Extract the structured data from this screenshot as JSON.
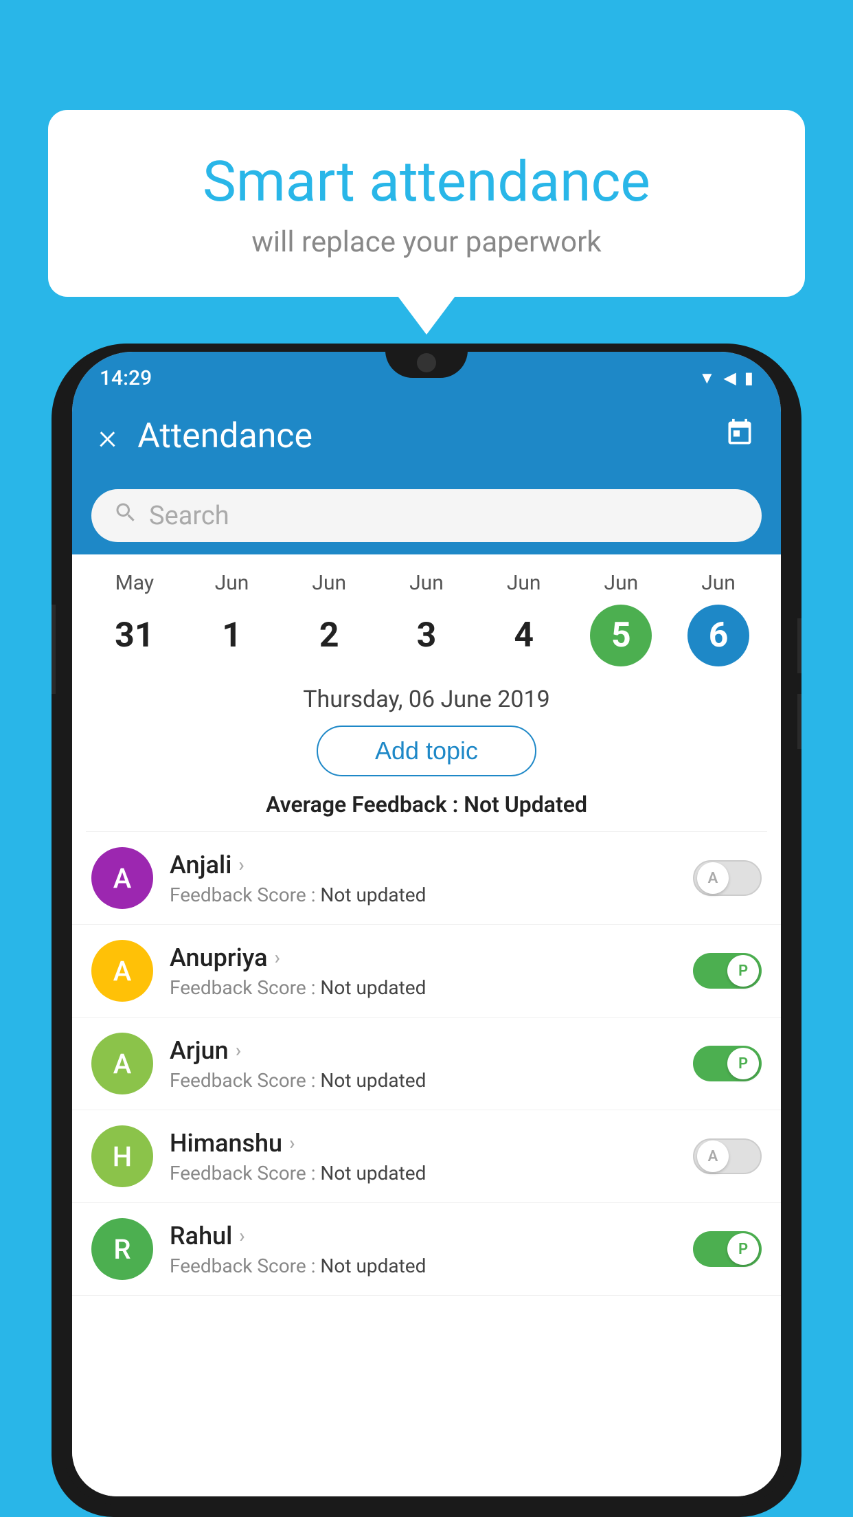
{
  "background_color": "#29B6E8",
  "speech_bubble": {
    "title": "Smart attendance",
    "subtitle": "will replace your paperwork"
  },
  "status_bar": {
    "time": "14:29",
    "icons": [
      "wifi",
      "signal",
      "battery"
    ]
  },
  "app_bar": {
    "title": "Attendance",
    "close_label": "×",
    "calendar_icon": "📅"
  },
  "search": {
    "placeholder": "Search"
  },
  "calendar": {
    "days": [
      {
        "month": "May",
        "date": "31",
        "state": "normal"
      },
      {
        "month": "Jun",
        "date": "1",
        "state": "normal"
      },
      {
        "month": "Jun",
        "date": "2",
        "state": "normal"
      },
      {
        "month": "Jun",
        "date": "3",
        "state": "normal"
      },
      {
        "month": "Jun",
        "date": "4",
        "state": "normal"
      },
      {
        "month": "Jun",
        "date": "5",
        "state": "today"
      },
      {
        "month": "Jun",
        "date": "6",
        "state": "selected"
      }
    ]
  },
  "selected_date": "Thursday, 06 June 2019",
  "add_topic_label": "Add topic",
  "average_feedback": {
    "label": "Average Feedback :",
    "value": "Not Updated"
  },
  "students": [
    {
      "name": "Anjali",
      "avatar_letter": "A",
      "avatar_color": "#9C27B0",
      "feedback": "Not updated",
      "attendance": "absent",
      "toggle_label": "A"
    },
    {
      "name": "Anupriya",
      "avatar_letter": "A",
      "avatar_color": "#FFC107",
      "feedback": "Not updated",
      "attendance": "present",
      "toggle_label": "P"
    },
    {
      "name": "Arjun",
      "avatar_letter": "A",
      "avatar_color": "#8BC34A",
      "feedback": "Not updated",
      "attendance": "present",
      "toggle_label": "P"
    },
    {
      "name": "Himanshu",
      "avatar_letter": "H",
      "avatar_color": "#8BC34A",
      "feedback": "Not updated",
      "attendance": "absent",
      "toggle_label": "A"
    },
    {
      "name": "Rahul",
      "avatar_letter": "R",
      "avatar_color": "#4CAF50",
      "feedback": "Not updated",
      "attendance": "present",
      "toggle_label": "P"
    }
  ],
  "feedback_label": "Feedback Score :",
  "feedback_value": "Not updated"
}
